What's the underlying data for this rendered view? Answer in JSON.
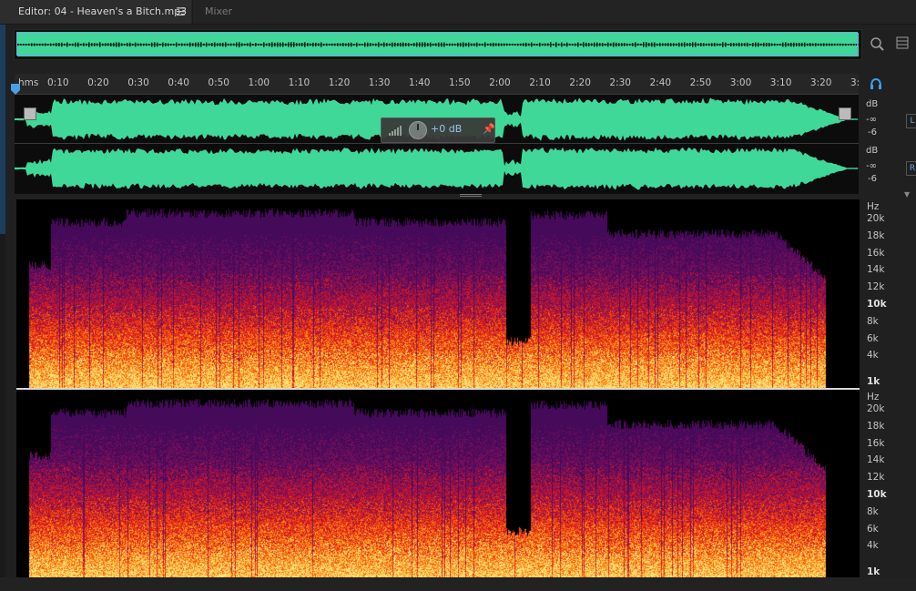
{
  "tabs": {
    "editor_label": "Editor: 04 - Heaven's a Bitch.mp3",
    "mixer_label": "Mixer"
  },
  "ruler": {
    "unit": "hms",
    "ticks": [
      "0:10",
      "0:20",
      "0:30",
      "0:40",
      "0:50",
      "1:00",
      "1:10",
      "1:20",
      "1:30",
      "1:40",
      "1:50",
      "2:00",
      "2:10",
      "2:20",
      "2:30",
      "2:40",
      "2:50",
      "3:00",
      "3:10",
      "3:20",
      "3:"
    ]
  },
  "waveform": {
    "scale_unit": "dB",
    "neg_inf": "-∞",
    "minus6": "-6",
    "left_channel": "L",
    "right_channel": "R",
    "color": "#40d898"
  },
  "hud": {
    "volume": "+0 dB"
  },
  "spectral": {
    "unit": "Hz",
    "labels": [
      "20k",
      "18k",
      "16k",
      "14k",
      "12k",
      "10k",
      "8k",
      "6k",
      "4k",
      "1k"
    ]
  },
  "icons": {
    "zoom": "zoom-icon",
    "panel": "panel-menu-icon",
    "headphones": "headphones-icon",
    "pin": "pin-icon"
  }
}
